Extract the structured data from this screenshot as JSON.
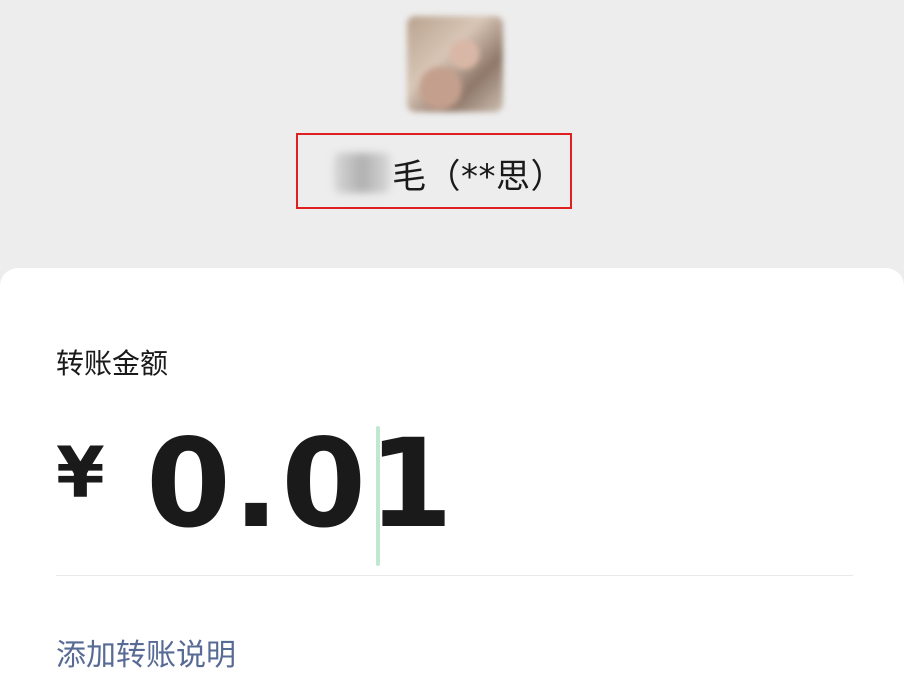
{
  "recipient": {
    "avatar_icon": "blurred-avatar-photo",
    "name": "毛（**思）"
  },
  "transfer": {
    "amount_label": "转账金额",
    "currency_symbol": "¥",
    "amount": "0.01",
    "add_note_link": "添加转账说明"
  },
  "colors": {
    "header_bg": "#ededed",
    "panel_bg": "#ffffff",
    "text_primary": "#1a1a1a",
    "link_blue": "#576b95",
    "cursor_green": "#bfe8d1",
    "highlight_red": "#e02020"
  }
}
